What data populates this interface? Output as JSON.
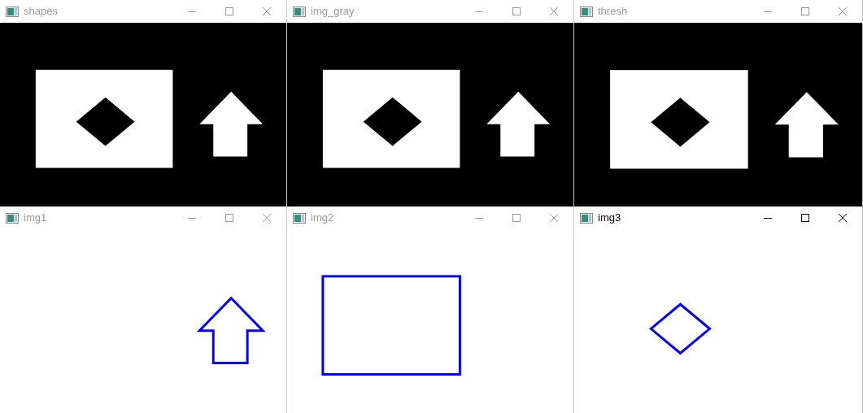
{
  "windows": [
    {
      "title": "shapes",
      "active": false,
      "kind": "filled"
    },
    {
      "title": "img_gray",
      "active": false,
      "kind": "filled"
    },
    {
      "title": "thresh",
      "active": false,
      "kind": "filled"
    },
    {
      "title": "img1",
      "active": false,
      "kind": "arrow"
    },
    {
      "title": "img2",
      "active": false,
      "kind": "rectangle"
    },
    {
      "title": "img3",
      "active": true,
      "kind": "diamond"
    }
  ]
}
